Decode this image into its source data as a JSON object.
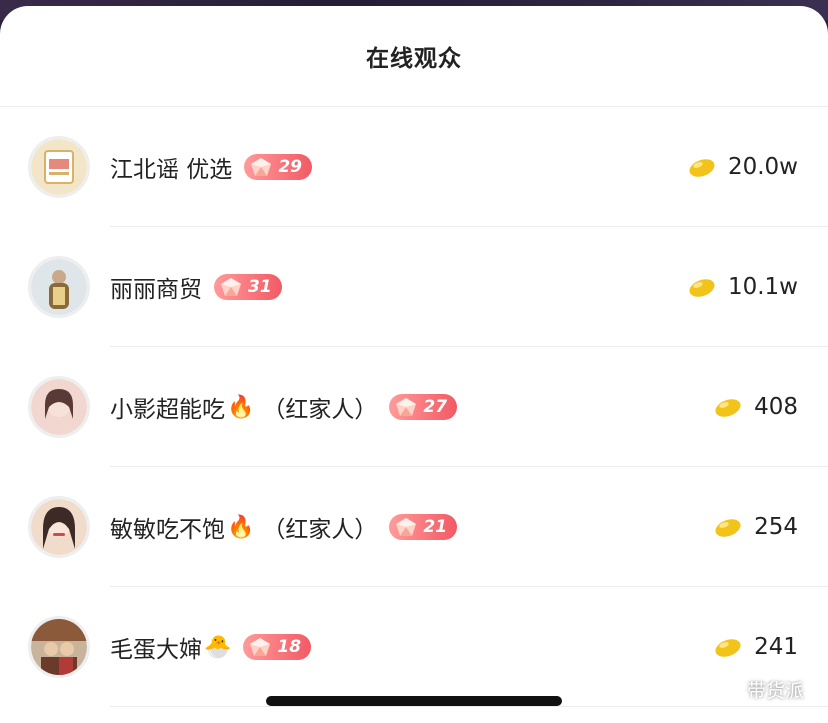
{
  "header": {
    "title": "在线观众"
  },
  "audience": [
    {
      "name": "江北谣 优选",
      "emoji": "",
      "suffix": "",
      "level": "29",
      "value": "20.0w",
      "avatar_colors": [
        "#f3e6c8",
        "#d9b26a"
      ]
    },
    {
      "name": "丽丽商贸",
      "emoji": "",
      "suffix": "",
      "level": "31",
      "value": "10.1w",
      "avatar_colors": [
        "#dfe6ea",
        "#8a6a3a"
      ]
    },
    {
      "name": "小影超能吃",
      "emoji": "🔥",
      "suffix": "（红家人）",
      "level": "27",
      "value": "408",
      "avatar_colors": [
        "#f2d6d0",
        "#5a3a36"
      ]
    },
    {
      "name": "敏敏吃不饱",
      "emoji": "🔥",
      "suffix": "（红家人）",
      "level": "21",
      "value": "254",
      "avatar_colors": [
        "#f1dccb",
        "#3b2a26"
      ]
    },
    {
      "name": "毛蛋大婶",
      "emoji": "🐣",
      "suffix": "",
      "level": "18",
      "value": "241",
      "avatar_colors": [
        "#c7b49a",
        "#6a3b2a"
      ]
    }
  ],
  "watermark": {
    "text": "带货派"
  },
  "colors": {
    "badge_start": "#ff9a9a",
    "badge_end": "#f25a64",
    "bean": "#f2c318"
  },
  "icons": {
    "level_badge": "gem-icon",
    "currency": "gold-bean-icon",
    "watermark": "wechat-icon"
  }
}
